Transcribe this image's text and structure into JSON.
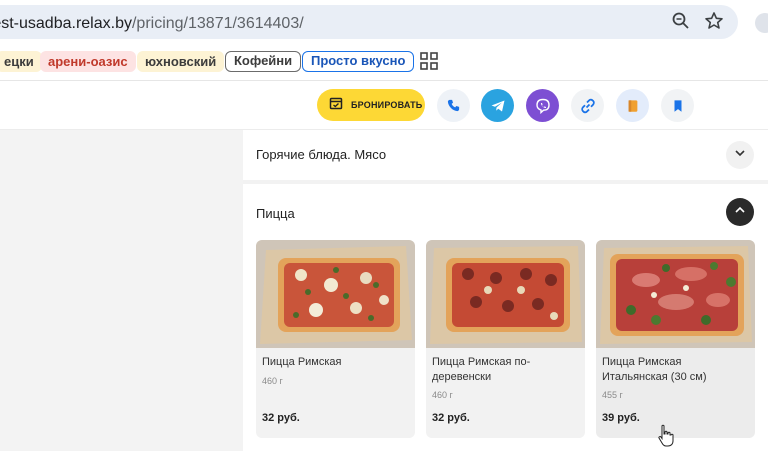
{
  "browser": {
    "url_host": "rest-usadba.relax.by",
    "url_path": "/pricing/13871/3614403/",
    "icons": [
      "zoom-icon",
      "star-icon"
    ]
  },
  "bookmarks": [
    {
      "label": "ецки"
    },
    {
      "label": "арени-оазис"
    },
    {
      "label": "юхновский"
    },
    {
      "label": "Кофейни"
    },
    {
      "label": "Просто вкусно"
    }
  ],
  "header": {
    "book_label": "БРОНИРОВАТЬ",
    "accent": "#fdd835",
    "buttons": [
      "phone-icon",
      "telegram-icon",
      "viber-icon",
      "link-icon",
      "menu-book-icon",
      "bookmark-icon"
    ]
  },
  "categories": [
    {
      "title": "Горячие блюда. Мясо",
      "expanded": false
    },
    {
      "title": "Пицца",
      "expanded": true
    }
  ],
  "products": [
    {
      "name": "Пицца Римская",
      "weight": "460 г",
      "price": "32 руб."
    },
    {
      "name": "Пицца Римская по-деревенски",
      "weight": "460 г",
      "price": "32 руб."
    },
    {
      "name": "Пицца Римская Итальянская (30 см)",
      "weight": "455 г",
      "price": "39 руб."
    }
  ]
}
